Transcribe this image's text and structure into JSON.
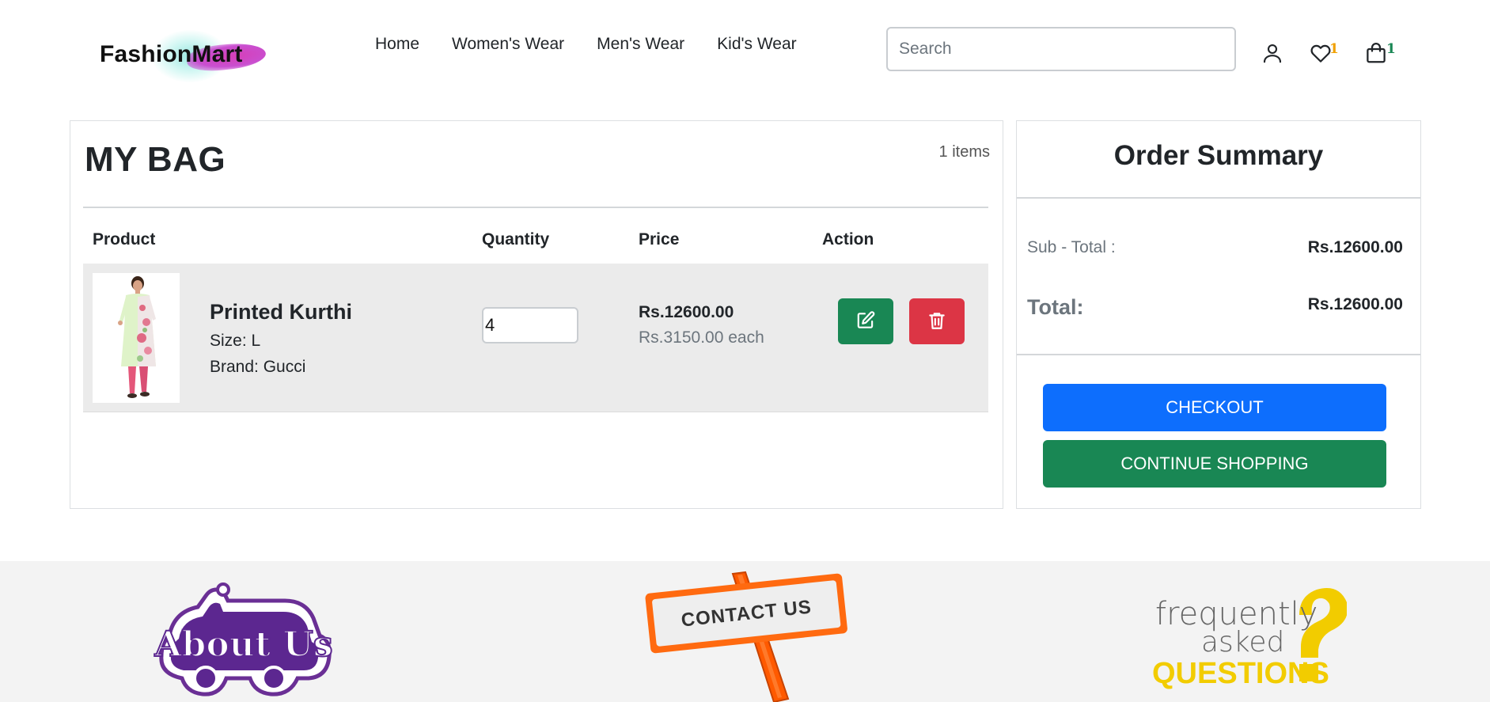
{
  "navbar": {
    "brand": "FashionMart",
    "links": [
      "Home",
      "Women's Wear",
      "Men's Wear",
      "Kid's Wear"
    ],
    "search_placeholder": "Search",
    "wishlist_count": "1",
    "cart_count": "1",
    "icons": [
      "user-icon",
      "heart-icon",
      "shopping-bag-icon"
    ]
  },
  "bag": {
    "title": "MY BAG",
    "item_count": "1 items",
    "columns": [
      "Product",
      "Quantity",
      "Price",
      "Action"
    ],
    "items": [
      {
        "name": "Printed Kurthi",
        "size": "Size: L",
        "brand": "Brand: Gucci",
        "quantity": "4",
        "price_total": "Rs.12600.00",
        "price_each": "Rs.3150.00 each",
        "actions": [
          "edit-icon",
          "trash-icon"
        ]
      }
    ]
  },
  "summary": {
    "title": "Order Summary",
    "subtotal_label": "Sub - Total :",
    "subtotal_value": "Rs.12600.00",
    "total_label": "Total:",
    "total_value": "Rs.12600.00",
    "checkout_label": "CHECKOUT",
    "continue_label": "CONTINUE SHOPPING"
  },
  "footer": {
    "about_text": "About Us",
    "contact_text": "CONTACT US",
    "faq_line1": "frequently",
    "faq_line2": "asked",
    "faq_line3": "QUESTIONS"
  },
  "colors": {
    "primary": "#0d6efd",
    "success": "#198754",
    "danger": "#dc3545",
    "wishlist_badge": "#f0a000"
  }
}
